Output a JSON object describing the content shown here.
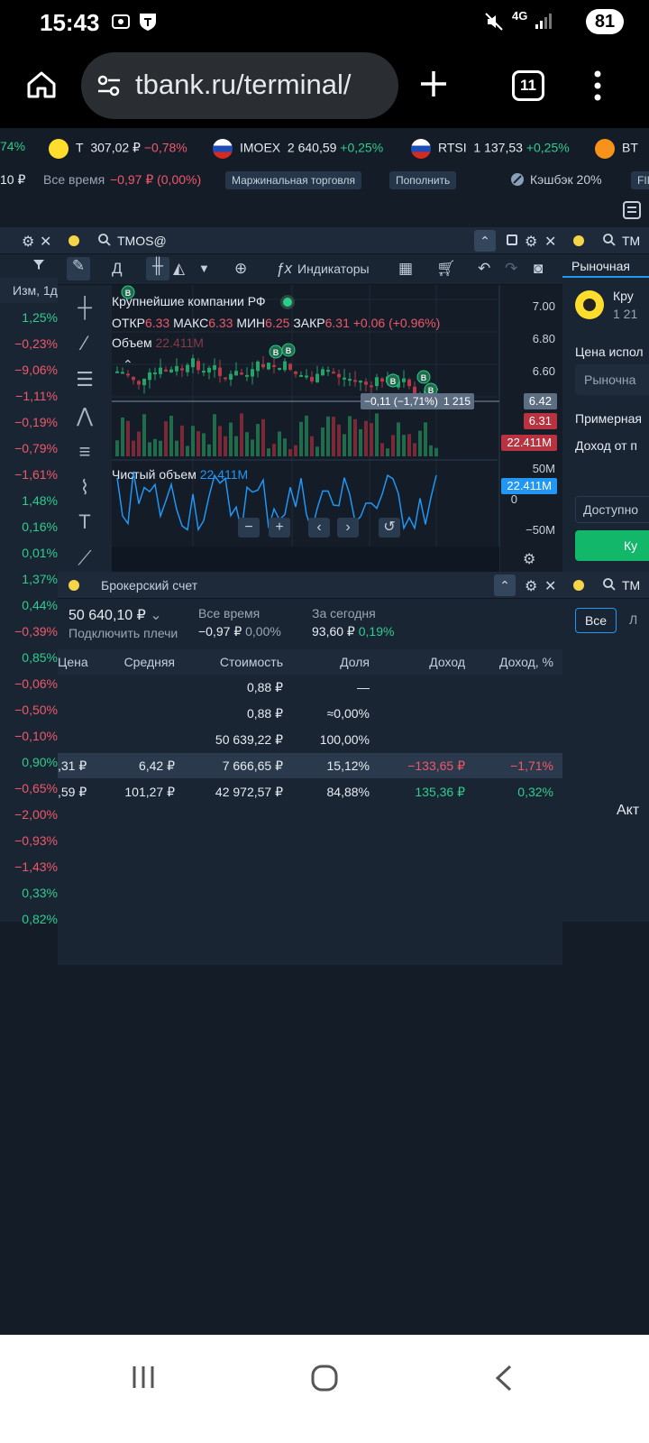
{
  "status_bar": {
    "time": "15:43",
    "network": "4G",
    "battery": "81"
  },
  "browser": {
    "url": "tbank.ru/terminal/",
    "tab_count": "11"
  },
  "ticker": [
    {
      "pct": "74%",
      "pct_color": "green"
    },
    {
      "name": "T",
      "price": "307,02 ₽",
      "change": "−0,78%",
      "change_color": "red"
    },
    {
      "name": "IMOEX",
      "price": "2 640,59",
      "change": "+0,25%",
      "change_color": "green"
    },
    {
      "name": "RTSI",
      "price": "1 137,53",
      "change": "+0,25%",
      "change_color": "green"
    },
    {
      "name": "BT"
    }
  ],
  "account_strip": {
    "left_value": "10 ₽",
    "period_label": "Все время",
    "period_change": "−0,97 ₽ (0,00%)",
    "margin_button": "Маржинальная торговля",
    "topup_button": "Пополнить",
    "cashback": "Кэшбэк 20%",
    "cut_pill": "FII"
  },
  "left_list": {
    "header": "Изм, 1д",
    "values": [
      "1,25%",
      "−0,23%",
      "−9,06%",
      "−1,11%",
      "−0,19%",
      "−0,79%",
      "−1,61%",
      "1,48%",
      "0,16%",
      "0,01%",
      "1,37%",
      "0,44%",
      "−0,39%",
      "0,85%",
      "−0,06%",
      "−0,50%",
      "−0,10%",
      "0,90%",
      "−0,65%",
      "−2,00%",
      "−0,93%",
      "−1,43%",
      "0,33%",
      "0,82%"
    ]
  },
  "chart_panel": {
    "ticker": "TMOS@",
    "toolbar": {
      "period": "Д",
      "indicators": "Индикаторы"
    },
    "instrument_name": "Крупнейшие компании РФ",
    "ohlc": {
      "open_label": "ОТКР",
      "open": "6.33",
      "high_label": "МАКС",
      "high": "6.33",
      "low_label": "МИН",
      "low": "6.25",
      "close_label": "ЗАКР",
      "close": "6.31",
      "change": "+0.06 (+0.96%)"
    },
    "volume_label": "Объем",
    "volume_value": "22.411M",
    "net_volume_label": "Чистый объем",
    "net_volume_value": "22.411M",
    "price_axis": [
      "7.00",
      "6.80",
      "6.60",
      "6.42",
      "6.31"
    ],
    "volume_tag": "22.411M",
    "net_axis": [
      "50M",
      "22.411M",
      "0",
      "−50M"
    ],
    "crosshair_tip": "−0,11 (−1,71%)",
    "crosshair_count": "1 215",
    "marker_letter": "B"
  },
  "broker_panel": {
    "title": "Брокерский счет",
    "total": "50 640,10 ₽",
    "leverage_link": "Подключить плечи",
    "all_time_label": "Все время",
    "all_time_value": "−0,97 ₽",
    "all_time_pct": "0,00%",
    "today_label": "За сегодня",
    "today_value": "93,60 ₽",
    "today_pct": "0,19%",
    "columns": [
      "Цена",
      "Средняя",
      "Стоимость",
      "Доля",
      "Доход",
      "Доход, %"
    ],
    "rows": [
      {
        "price": "",
        "avg": "",
        "value": "0,88 ₽",
        "share": "—",
        "income": "",
        "income_pct": ""
      },
      {
        "price": "",
        "avg": "",
        "value": "0,88 ₽",
        "share": "≈0,00%",
        "income": "",
        "income_pct": ""
      },
      {
        "price": "",
        "avg": "",
        "value": "50 639,22 ₽",
        "share": "100,00%",
        "income": "",
        "income_pct": ""
      },
      {
        "price": ",31 ₽",
        "avg": "6,42 ₽",
        "value": "7 666,65 ₽",
        "share": "15,12%",
        "income": "−133,65 ₽",
        "income_pct": "−1,71%"
      },
      {
        "price": ",59 ₽",
        "avg": "101,27 ₽",
        "value": "42 972,57 ₽",
        "share": "84,88%",
        "income": "135,36 ₽",
        "income_pct": "0,32%"
      }
    ]
  },
  "order_panel": {
    "ticker_cut": "TM",
    "tab": "Рыночная",
    "instrument_cut": "Кру",
    "instrument_price_cut": "1 21",
    "price_label": "Цена испол",
    "price_placeholder": "Рыночна",
    "approx_label": "Примерная",
    "income_label": "Доход от п",
    "available_label": "Доступно",
    "buy_button": "Ку"
  },
  "orders_panel": {
    "ticker_cut": "TM",
    "filter_all": "Все",
    "filter_cut": "Л",
    "status_cut": "Акт"
  },
  "colors": {
    "bg": "#131c27",
    "panel": "#1a2533",
    "green": "#2ecc8e",
    "red": "#f0586a",
    "accent": "#2196f3",
    "buy": "#12b76a"
  }
}
